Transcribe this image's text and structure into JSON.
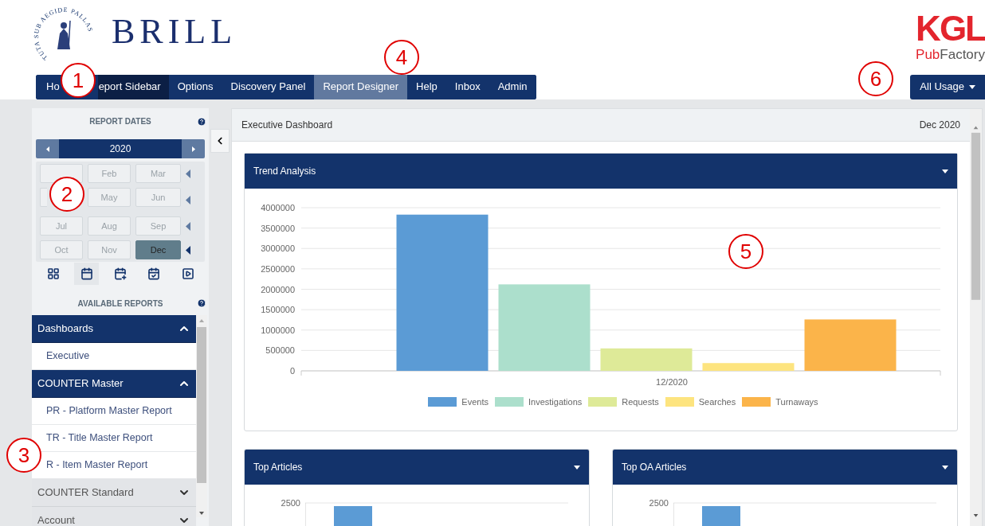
{
  "header": {
    "emblem_motto": "TUTA SUB AEGIDE PALLAS",
    "brand": "BRILL",
    "partner_logo": {
      "main": "KGL",
      "sub_a": "Pub",
      "sub_b": "Factory"
    }
  },
  "nav": [
    {
      "label": "Ho",
      "selected": false,
      "highlighted": false
    },
    {
      "label": "eport Sidebar",
      "selected": true,
      "highlighted": false
    },
    {
      "label": "Options",
      "selected": false,
      "highlighted": false
    },
    {
      "label": "Discovery Panel",
      "selected": false,
      "highlighted": false
    },
    {
      "label": "Report Designer",
      "selected": false,
      "highlighted": true
    },
    {
      "label": "Help",
      "selected": false,
      "highlighted": false
    },
    {
      "label": "Inbox",
      "selected": false,
      "highlighted": false
    },
    {
      "label": "Admin",
      "selected": false,
      "highlighted": false
    }
  ],
  "usage_button": {
    "label": "All Usage"
  },
  "sidebar": {
    "dates_title": "REPORT DATES",
    "year": "2020",
    "months": [
      {
        "kind": "month",
        "selected": false
      },
      {
        "kind": "month",
        "label": "Feb",
        "selected": false
      },
      {
        "kind": "month",
        "label": "Mar",
        "selected": false
      },
      {
        "kind": "sliver",
        "selected": false
      },
      {
        "kind": "month",
        "label": "May",
        "selected": false
      },
      {
        "kind": "month",
        "label": "Jun",
        "selected": false
      },
      {
        "kind": "month",
        "label": "Jul",
        "selected": false
      },
      {
        "kind": "month",
        "label": "Aug",
        "selected": false
      },
      {
        "kind": "month",
        "label": "Sep",
        "selected": false
      },
      {
        "kind": "month",
        "label": "Oct",
        "selected": false
      },
      {
        "kind": "month",
        "label": "Nov",
        "selected": false
      },
      {
        "kind": "month",
        "label": "Dec",
        "selected": true
      }
    ],
    "view_tabs": [
      {
        "kind": "grid",
        "selected": false
      },
      {
        "kind": "calendar",
        "selected": true
      },
      {
        "kind": "calendar-plus",
        "selected": false
      },
      {
        "kind": "calendar-check",
        "selected": false
      },
      {
        "kind": "play",
        "selected": false
      }
    ],
    "reports_title": "AVAILABLE REPORTS",
    "groups": [
      {
        "label": "Dashboards",
        "expanded": true,
        "children": [
          {
            "label": "Executive"
          }
        ]
      },
      {
        "label": "COUNTER Master",
        "expanded": true,
        "children": [
          {
            "label": "PR - Platform Master Report"
          },
          {
            "label": "TR - Title Master Report"
          },
          {
            "label": "R - Item Master Report"
          }
        ]
      },
      {
        "label": "COUNTER Standard",
        "expanded": false
      },
      {
        "label": "Account",
        "expanded": false
      }
    ]
  },
  "main": {
    "title": "Executive Dashboard",
    "period": "Dec 2020",
    "trend": {
      "title": "Trend Analysis",
      "chart_data": {
        "type": "bar",
        "grid": true,
        "legend": true,
        "categories": [
          "12/2020"
        ],
        "ylim": [
          0,
          4000000
        ],
        "yticks": [
          0,
          500000,
          1000000,
          1500000,
          2000000,
          2500000,
          3000000,
          3500000,
          4000000
        ],
        "series": [
          {
            "name": "Events",
            "color": "#5b9bd5",
            "values": [
              3830000
            ]
          },
          {
            "name": "Investigations",
            "color": "#acdfcc",
            "values": [
              2120000
            ]
          },
          {
            "name": "Requests",
            "color": "#deea98",
            "values": [
              550000
            ]
          },
          {
            "name": "Searches",
            "color": "#fde47f",
            "values": [
              190000
            ]
          },
          {
            "name": "Turnaways",
            "color": "#fbb44a",
            "values": [
              1260000
            ]
          }
        ]
      }
    },
    "cards": [
      {
        "title": "Top Articles",
        "tick": "2500"
      },
      {
        "title": "Top OA Articles",
        "tick": "2500"
      }
    ]
  },
  "callouts": [
    {
      "number": "1"
    },
    {
      "number": "2"
    },
    {
      "number": "3"
    },
    {
      "number": "4"
    },
    {
      "number": "5"
    },
    {
      "number": "6"
    }
  ]
}
